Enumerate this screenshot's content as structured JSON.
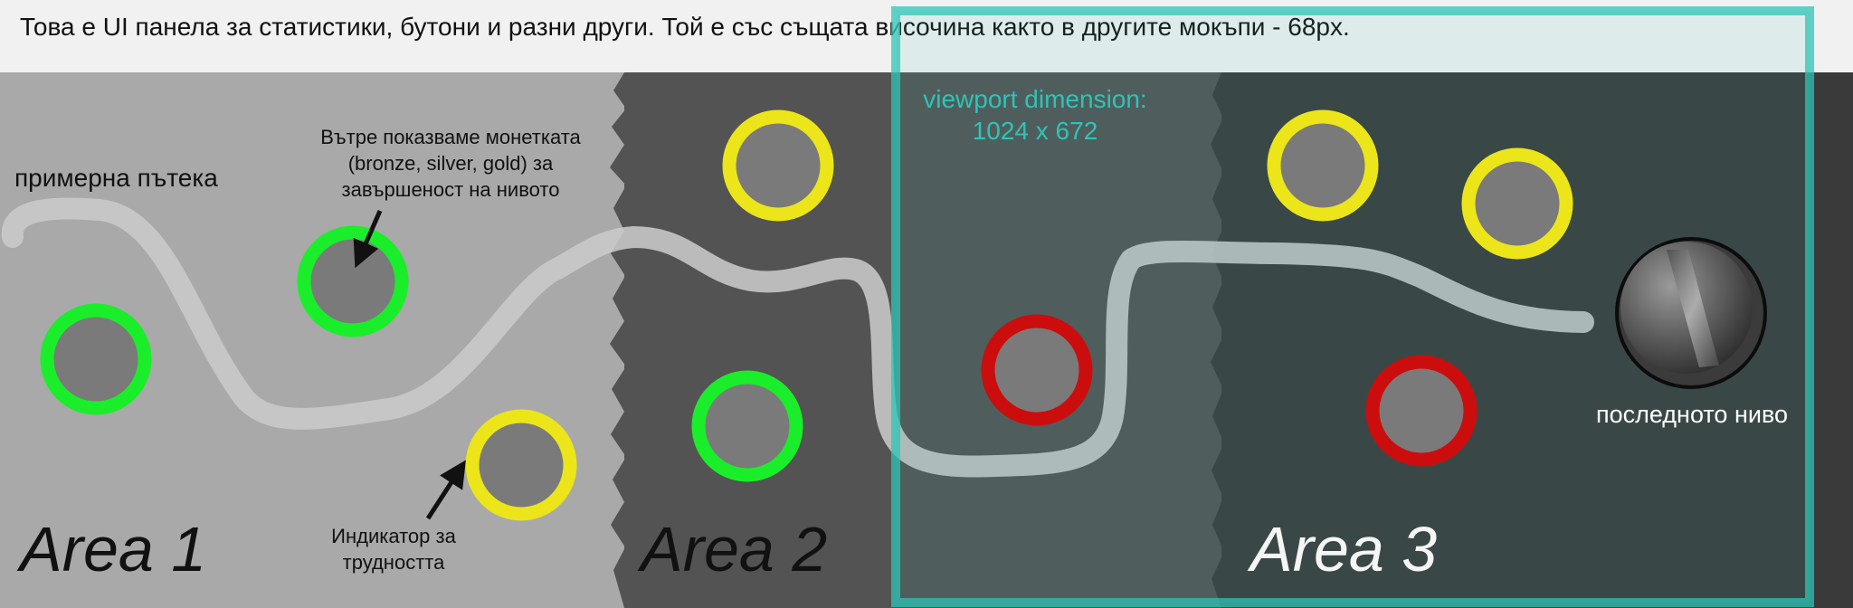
{
  "panel": {
    "description": "Това е UI панела за статистики, бутони и разни други. Той е със същата височина както в другите мокъпи - 68px."
  },
  "areas": [
    {
      "title": "Area 1",
      "color": "#111111"
    },
    {
      "title": "Area 2",
      "color": "#111111"
    },
    {
      "title": "Area 3",
      "color": "#f5f5f5"
    }
  ],
  "annotations": {
    "path_label": "примерна пътека",
    "coin_note": [
      "Вътре показваме монетката",
      "(bronze, silver, gold) за",
      "завършеност на нивото"
    ],
    "difficulty_note": [
      "Индикатор за",
      "трудността"
    ],
    "final_level": "последното ниво"
  },
  "viewport": {
    "label_line1": "viewport dimension:",
    "label_line2": "1024 x 672",
    "color": "#2ec4b6"
  },
  "difficulty_colors": {
    "easy": "#1aee2a",
    "medium": "#ece51a",
    "hard": "#cc0d0d"
  },
  "levels": [
    {
      "area": 1,
      "difficulty": "easy"
    },
    {
      "area": 1,
      "difficulty": "easy"
    },
    {
      "area": 1,
      "difficulty": "medium"
    },
    {
      "area": 2,
      "difficulty": "medium"
    },
    {
      "area": 2,
      "difficulty": "easy"
    },
    {
      "area": 2,
      "difficulty": "hard"
    },
    {
      "area": 3,
      "difficulty": "medium"
    },
    {
      "area": 3,
      "difficulty": "medium"
    },
    {
      "area": 3,
      "difficulty": "hard"
    }
  ]
}
